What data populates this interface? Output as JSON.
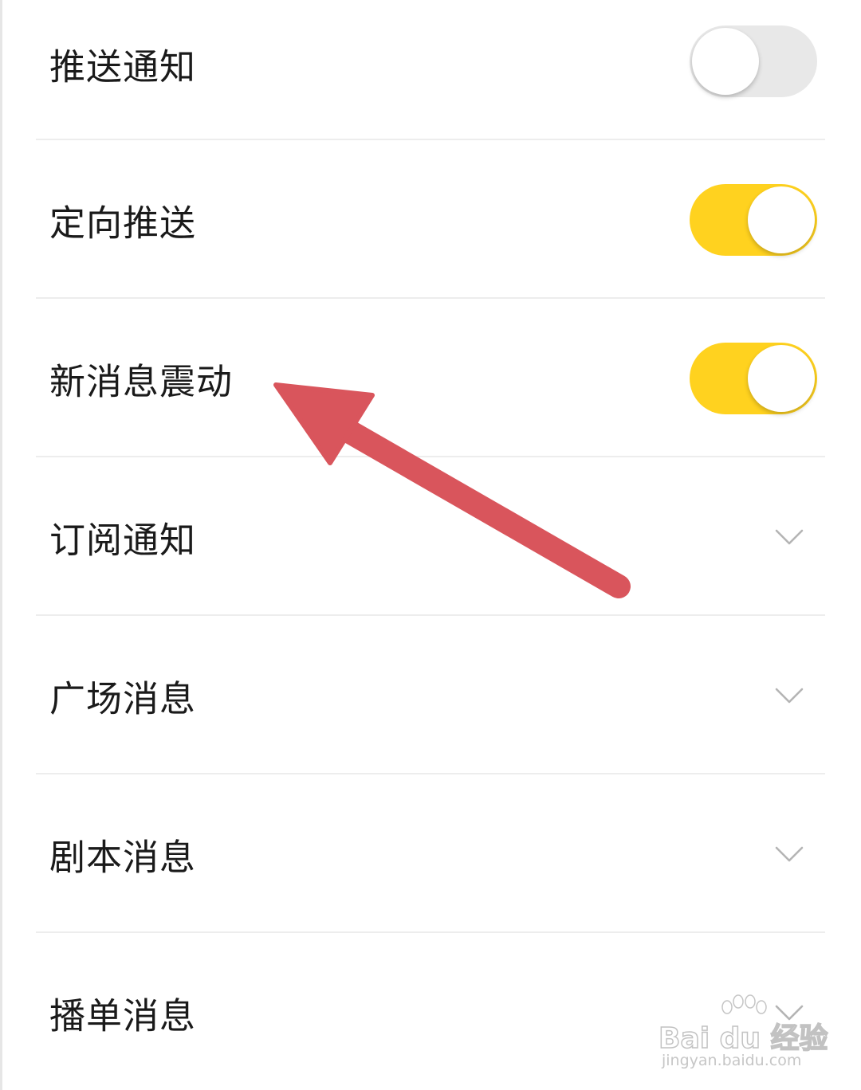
{
  "settings": {
    "rows": [
      {
        "label": "推送通知",
        "control": "toggle",
        "state": "off"
      },
      {
        "label": "定向推送",
        "control": "toggle",
        "state": "on"
      },
      {
        "label": "新消息震动",
        "control": "toggle",
        "state": "on"
      },
      {
        "label": "订阅通知",
        "control": "chevron"
      },
      {
        "label": "广场消息",
        "control": "chevron"
      },
      {
        "label": "剧本消息",
        "control": "chevron"
      },
      {
        "label": "播单消息",
        "control": "chevron"
      }
    ]
  },
  "colors": {
    "toggle_on": "#ffd21f",
    "toggle_off": "#e8e8e8",
    "annotation_arrow": "#d9555c",
    "divider": "#ededed"
  },
  "watermark": {
    "main": "Bai du 经验",
    "sub": "jingyan.baidu.com"
  }
}
